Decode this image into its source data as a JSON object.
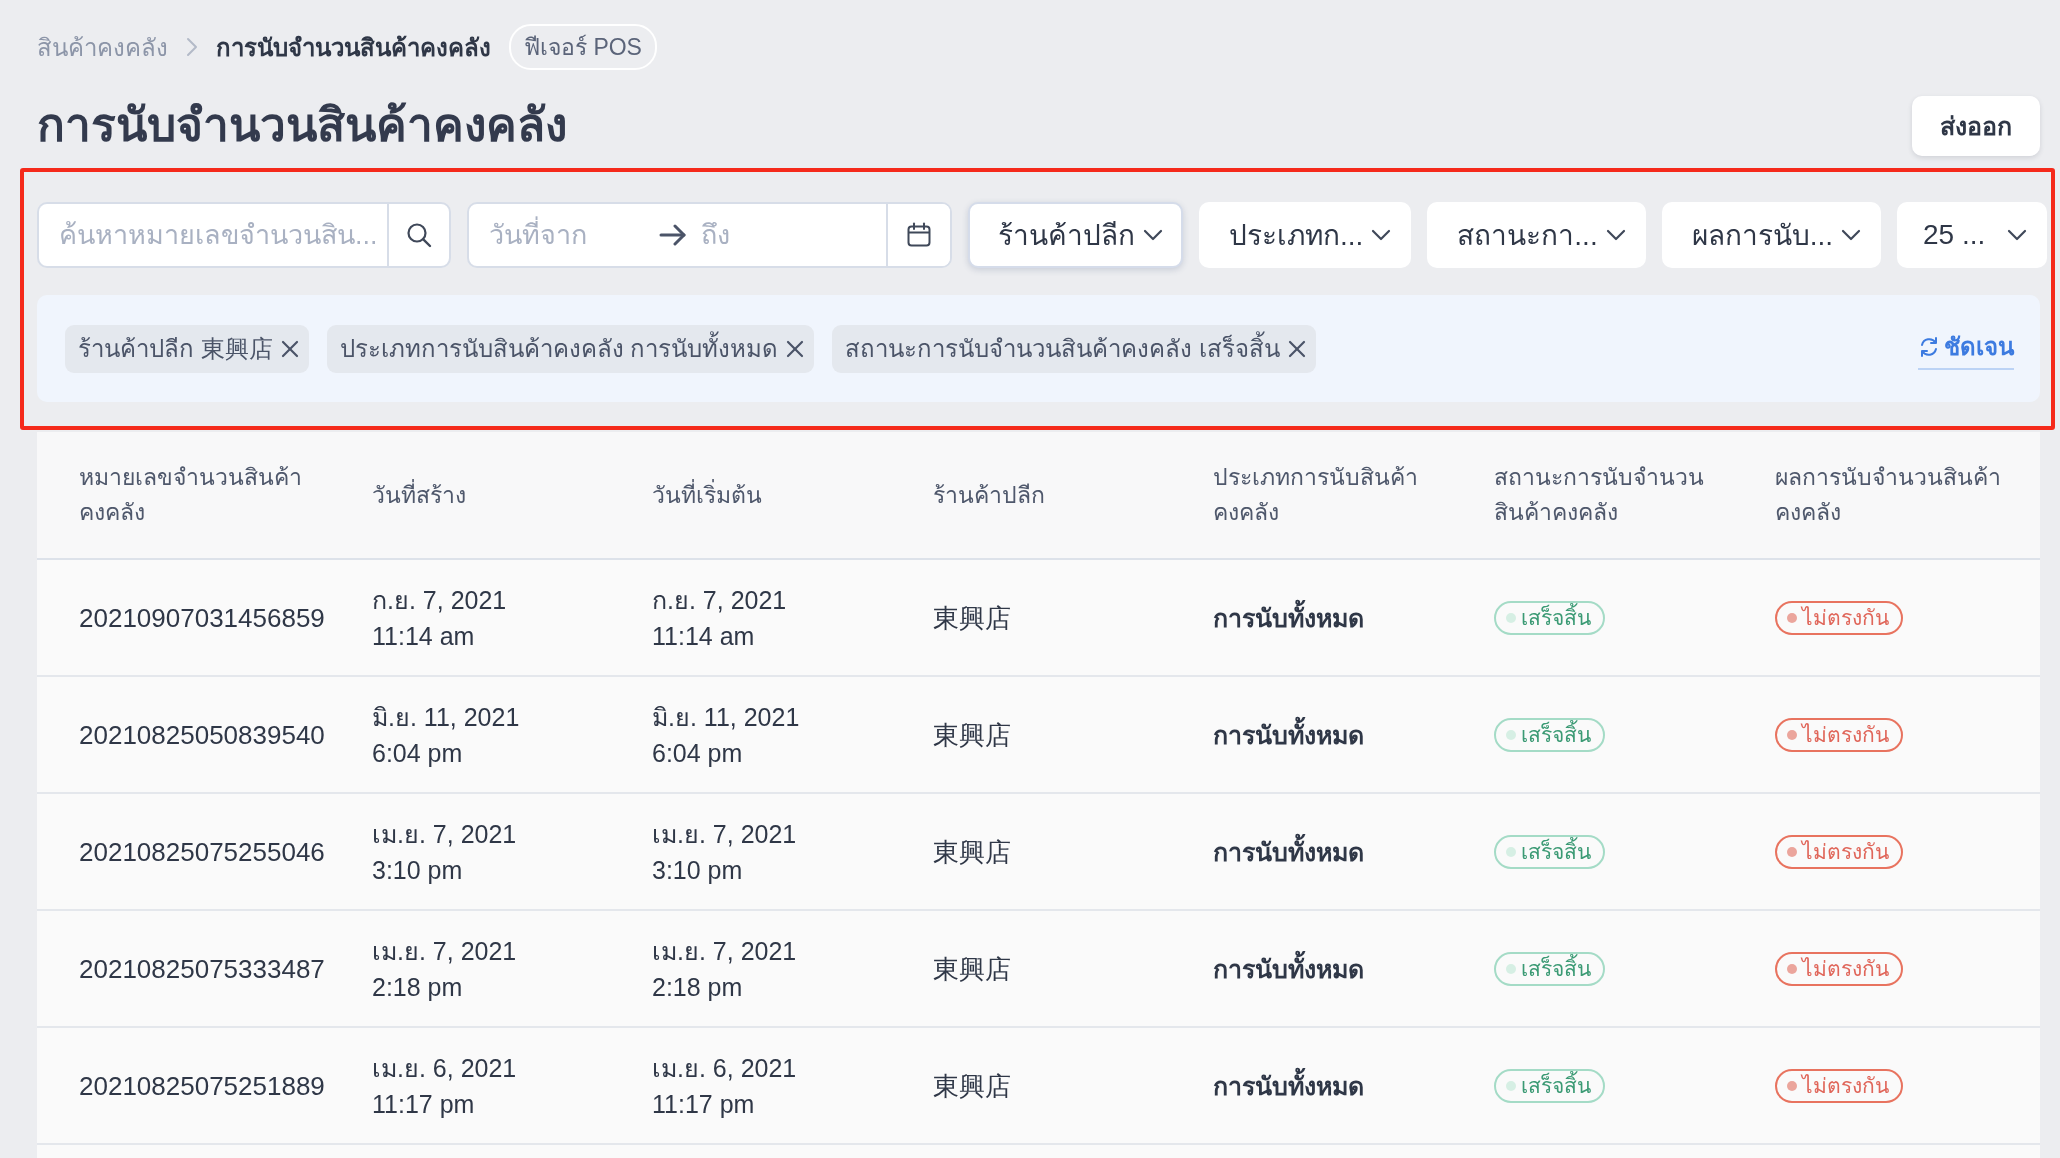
{
  "breadcrumb": {
    "items": [
      {
        "label": "สินค้าคงคลัง",
        "current": false
      },
      {
        "label": "การนับจำนวนสินค้าคงคลัง",
        "current": true
      }
    ],
    "badge": "ฟีเจอร์ POS"
  },
  "page": {
    "title": "การนับจำนวนสินค้าคงคลัง",
    "actions": [
      "ส่งออก"
    ]
  },
  "filters": {
    "highlighted": true,
    "search": {
      "placeholder": "ค้นหาหมายเลขจำนวนสิน..."
    },
    "date_range": {
      "start": {
        "placeholder": "วันที่จาก"
      },
      "end": {
        "placeholder": "ถึง"
      }
    },
    "dropdowns": [
      {
        "label": "ร้านค้าปลีก",
        "focused": true
      },
      {
        "label": "ประเภทก...",
        "focused": false
      },
      {
        "label": "สถานะกา...",
        "focused": false
      },
      {
        "label": "ผลการนับ...",
        "focused": false
      },
      {
        "label": "25 ...",
        "focused": false
      }
    ],
    "chips": [
      {
        "label": "ร้านค้าปลีก 東興店"
      },
      {
        "label": "ประเภทการนับสินค้าคงคลัง การนับทั้งหมด"
      },
      {
        "label": "สถานะการนับจำนวนสินค้าคงคลัง เสร็จสิ้น"
      }
    ],
    "clear_label": "ชัดเจน"
  },
  "table": {
    "columns": [
      "หมายเลขจำนวนสินค้าคงคลัง",
      "วันที่สร้าง",
      "วันที่เริ่มต้น",
      "ร้านค้าปลีก",
      "ประเภทการนับสินค้าคงคลัง",
      "สถานะการนับจำนวนสินค้าคงคลัง",
      "ผลการนับจำนวนสินค้าคงคลัง"
    ],
    "rows": [
      {
        "number": "20210907031456859",
        "created": {
          "date": "ก.ย. 7, 2021",
          "time": "11:14 am"
        },
        "started": {
          "date": "ก.ย. 7, 2021",
          "time": "11:14 am"
        },
        "store": "東興店",
        "type": "การนับทั้งหมด",
        "status": {
          "label": "เสร็จสิ้น",
          "kind": "success"
        },
        "result": {
          "label": "ไม่ตรงกัน",
          "kind": "danger"
        }
      },
      {
        "number": "20210825050839540",
        "created": {
          "date": "มิ.ย. 11, 2021",
          "time": "6:04 pm"
        },
        "started": {
          "date": "มิ.ย. 11, 2021",
          "time": "6:04 pm"
        },
        "store": "東興店",
        "type": "การนับทั้งหมด",
        "status": {
          "label": "เสร็จสิ้น",
          "kind": "success"
        },
        "result": {
          "label": "ไม่ตรงกัน",
          "kind": "danger"
        }
      },
      {
        "number": "20210825075255046",
        "created": {
          "date": "เม.ย. 7, 2021",
          "time": "3:10 pm"
        },
        "started": {
          "date": "เม.ย. 7, 2021",
          "time": "3:10 pm"
        },
        "store": "東興店",
        "type": "การนับทั้งหมด",
        "status": {
          "label": "เสร็จสิ้น",
          "kind": "success"
        },
        "result": {
          "label": "ไม่ตรงกัน",
          "kind": "danger"
        }
      },
      {
        "number": "20210825075333487",
        "created": {
          "date": "เม.ย. 7, 2021",
          "time": "2:18 pm"
        },
        "started": {
          "date": "เม.ย. 7, 2021",
          "time": "2:18 pm"
        },
        "store": "東興店",
        "type": "การนับทั้งหมด",
        "status": {
          "label": "เสร็จสิ้น",
          "kind": "success"
        },
        "result": {
          "label": "ไม่ตรงกัน",
          "kind": "danger"
        }
      },
      {
        "number": "20210825075251889",
        "created": {
          "date": "เม.ย. 6, 2021",
          "time": "11:17 pm"
        },
        "started": {
          "date": "เม.ย. 6, 2021",
          "time": "11:17 pm"
        },
        "store": "東興店",
        "type": "การนับทั้งหมด",
        "status": {
          "label": "เสร็จสิ้น",
          "kind": "success"
        },
        "result": {
          "label": "ไม่ตรงกัน",
          "kind": "danger"
        }
      }
    ]
  }
}
